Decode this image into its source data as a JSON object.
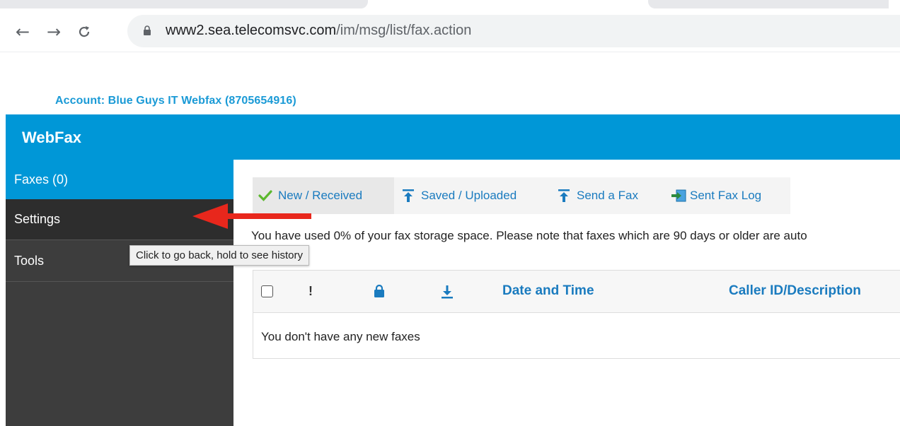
{
  "browser": {
    "url_host": "www2.sea.telecomsvc.com",
    "url_path": "/im/msg/list/fax.action",
    "icons": {
      "back": "arrow-left-icon",
      "forward": "arrow-right-icon",
      "reload": "reload-icon",
      "lock": "lock-icon"
    }
  },
  "account": {
    "label": "Account: Blue Guys IT Webfax (8705654916)"
  },
  "header": {
    "title": "WebFax",
    "color": "#0097d7"
  },
  "sidebar": {
    "items": [
      {
        "label": "Faxes (0)"
      },
      {
        "label": "Settings"
      },
      {
        "label": "Tools"
      }
    ]
  },
  "tabs": [
    {
      "label": "New / Received",
      "icon": "check-icon"
    },
    {
      "label": "Saved / Uploaded",
      "icon": "upload-icon"
    },
    {
      "label": "Send a Fax",
      "icon": "upload-icon"
    },
    {
      "label": "Sent Fax Log",
      "icon": "sent-log-icon"
    }
  ],
  "storage_note": "You have used 0% of your fax storage space. Please note that faxes which are 90 days or older are auto",
  "table": {
    "col_importance": "!",
    "col_date": "Date and Time",
    "col_callerid": "Caller ID/Description",
    "empty_message": "You don't have any new faxes"
  },
  "tooltip": {
    "text": "Click to go back, hold to see history"
  },
  "annotation": {
    "arrow_color": "#e8271c"
  }
}
